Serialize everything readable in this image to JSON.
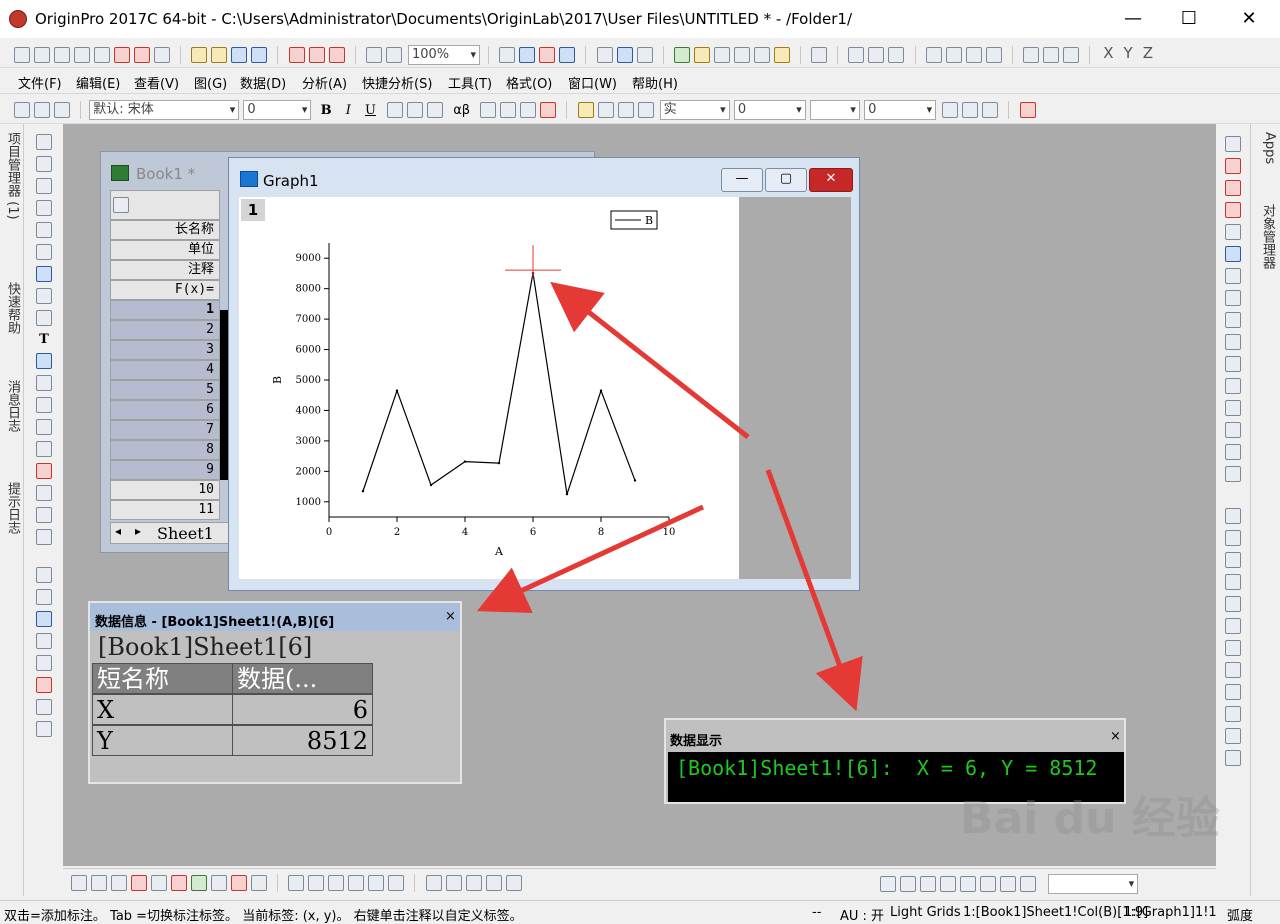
{
  "window": {
    "title": "OriginPro 2017C 64-bit - C:\\Users\\Administrator\\Documents\\OriginLab\\2017\\User Files\\UNTITLED * - /Folder1/",
    "minimize": "—",
    "maximize": "☐",
    "close": "✕"
  },
  "toolbar": {
    "zoom_value": "100%",
    "axis_buttons": [
      "X",
      "Y",
      "Z"
    ]
  },
  "menu": [
    "文件(F)",
    "编辑(E)",
    "查看(V)",
    "图(G)",
    "数据(D)",
    "分析(A)",
    "快捷分析(S)",
    "工具(T)",
    "格式(O)",
    "窗口(W)",
    "帮助(H)"
  ],
  "format_toolbar": {
    "font_name": "默认: 宋体",
    "font_size": "0",
    "bold": "B",
    "italic": "I",
    "underline": "U",
    "greek": "αβ",
    "line_style": "实",
    "line_width": "0",
    "fill_width": "0"
  },
  "left_dock": {
    "tabs": [
      "项目管理器 (1)",
      "快速帮助",
      "消息日志",
      "提示日志"
    ]
  },
  "right_dock": {
    "tabs": [
      "Apps",
      "对象管理器"
    ]
  },
  "book": {
    "title": "Book1 *",
    "header_labels": [
      "长名称",
      "单位",
      "注释",
      "F(x)="
    ],
    "rows": [
      "1",
      "2",
      "3",
      "4",
      "5",
      "6",
      "7",
      "8",
      "9",
      "10",
      "11"
    ],
    "sheet_tab": "Sheet1"
  },
  "graph": {
    "title": "Graph1",
    "layer": "1",
    "minimize": "—",
    "restore": "▢",
    "close": "✕",
    "legend": "B",
    "xlabel": "A",
    "ylabel": "B"
  },
  "chart_data": {
    "type": "line",
    "x": [
      1,
      2,
      3,
      4,
      5,
      6,
      7,
      8,
      9
    ],
    "series": [
      {
        "name": "B",
        "values": [
          1350,
          4650,
          1550,
          2320,
          2270,
          8512,
          1250,
          4650,
          1700
        ]
      }
    ],
    "xlabel": "A",
    "ylabel": "B",
    "xlim": [
      0,
      10
    ],
    "ylim": [
      500,
      9500
    ],
    "xticks": [
      "0",
      "2",
      "4",
      "6",
      "8",
      "10"
    ],
    "yticks": [
      "1000",
      "2000",
      "3000",
      "4000",
      "5000",
      "6000",
      "7000",
      "8000",
      "9000"
    ],
    "grid": false,
    "legend": "top-right",
    "highlight": {
      "x": 6,
      "y": 8512
    }
  },
  "data_info": {
    "header": "数据信息 - [Book1]Sheet1!(A,B)[6]",
    "close": "×",
    "title": "[Book1]Sheet1[6]",
    "col1": "短名称",
    "col2": "数据(...",
    "rows": [
      {
        "name": "X",
        "value": "6"
      },
      {
        "name": "Y",
        "value": "8512"
      }
    ]
  },
  "data_display": {
    "header": "数据显示",
    "close": "×",
    "text": "[Book1]Sheet1![6]:  X = 6, Y = 8512"
  },
  "status": {
    "hint": "双击=添加标注。 Tab =切换标注标签。 当前标签: (x, y)。 右键单击注释以自定义标签。",
    "dashes": "--",
    "au": "AU : 开",
    "grids": "Light Grids",
    "column": "1:[Book1]Sheet1!Col(B)[1:9]",
    "graph_ref": "1:[Graph1]1!1",
    "unit": "弧度"
  },
  "colors": {
    "accent_red": "#e53935",
    "data_green": "#1ec81e",
    "panel_header": "#a9bedb"
  }
}
